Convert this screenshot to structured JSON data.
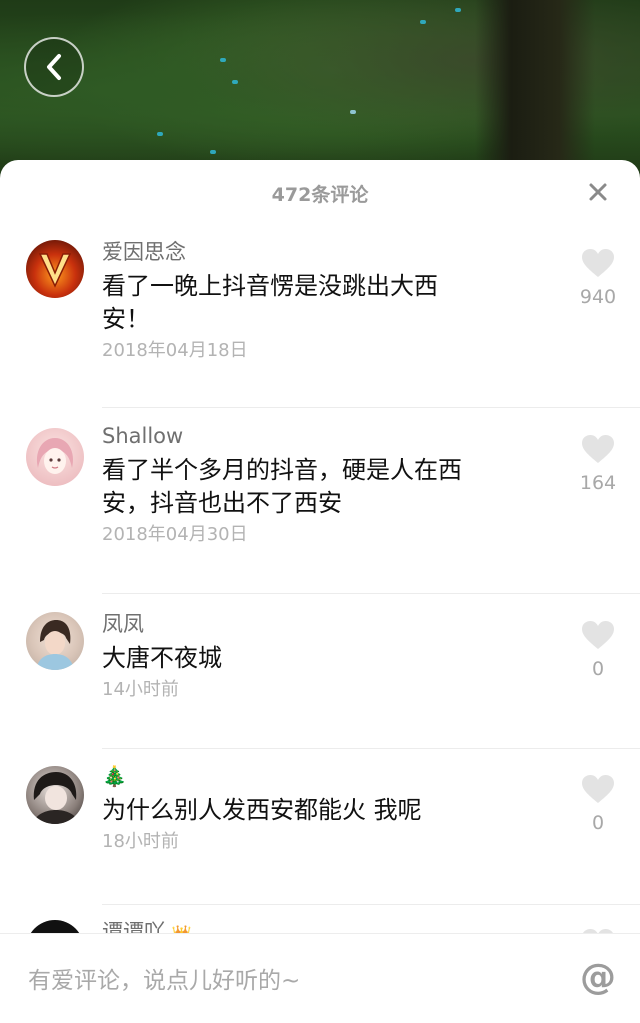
{
  "header": {
    "comment_count_title": "472条评论",
    "back_icon": "chevron-left-icon",
    "close_icon": "close-icon"
  },
  "comments": [
    {
      "user": "爱因思念",
      "text": "看了一晚上抖音愣是没跳出大西安！",
      "time": "2018年04月18日",
      "likes": "940",
      "avatar": "flame-v-avatar"
    },
    {
      "user": "Shallow",
      "text": "看了半个多月的抖音，硬是人在西安，抖音也出不了西安",
      "time": "2018年04月30日",
      "likes": "164",
      "avatar": "cartoon-girl-avatar"
    },
    {
      "user": "凤凤",
      "text": "大唐不夜城",
      "time": "14小时前",
      "likes": "0",
      "avatar": "woman-photo-avatar"
    },
    {
      "user": "",
      "badge": "🎄",
      "text": "为什么别人发西安都能火 我呢",
      "time": "18小时前",
      "likes": "0",
      "avatar": "woman-selfie-avatar"
    },
    {
      "user": "谭谭吖",
      "badge": "👑",
      "avatar": "dark-avatar"
    }
  ],
  "input": {
    "placeholder": "有爱评论，说点儿好听的~",
    "at_symbol": "@"
  },
  "colors": {
    "sheet_bg": "#ffffff",
    "muted_text": "#9a9a9a",
    "heart": "#e3e3e3"
  }
}
